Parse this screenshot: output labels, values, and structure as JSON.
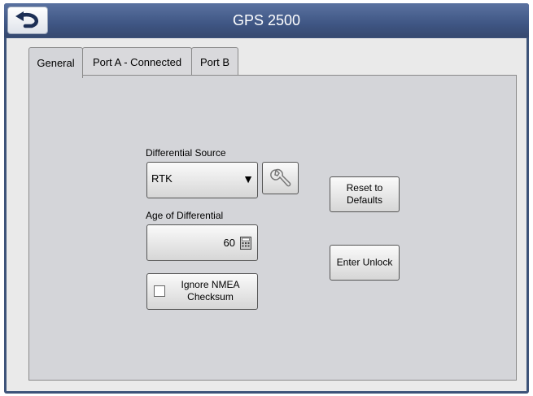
{
  "header": {
    "title": "GPS 2500",
    "back_icon": "undo-arrow-icon"
  },
  "tabs": [
    {
      "label": "General",
      "active": true
    },
    {
      "label": "Port A - Connected",
      "active": false
    },
    {
      "label": "Port B",
      "active": false
    }
  ],
  "general": {
    "differential_source": {
      "label": "Differential Source",
      "value": "RTK",
      "dropdown_icon": "triangle-down-icon",
      "settings_icon": "wrench-icon"
    },
    "age_of_differential": {
      "label": "Age of Differential",
      "value": "60",
      "icon": "calculator-icon"
    },
    "ignore_nmea": {
      "label_line1": "Ignore NMEA",
      "label_line2": "Checksum",
      "checked": false
    },
    "reset_button": {
      "line1": "Reset to",
      "line2": "Defaults"
    },
    "unlock_button": {
      "label": "Enter Unlock"
    }
  },
  "colors": {
    "title_bar": "#3f5684",
    "frame": "#3d5379",
    "panel": "#d4d5d9"
  }
}
